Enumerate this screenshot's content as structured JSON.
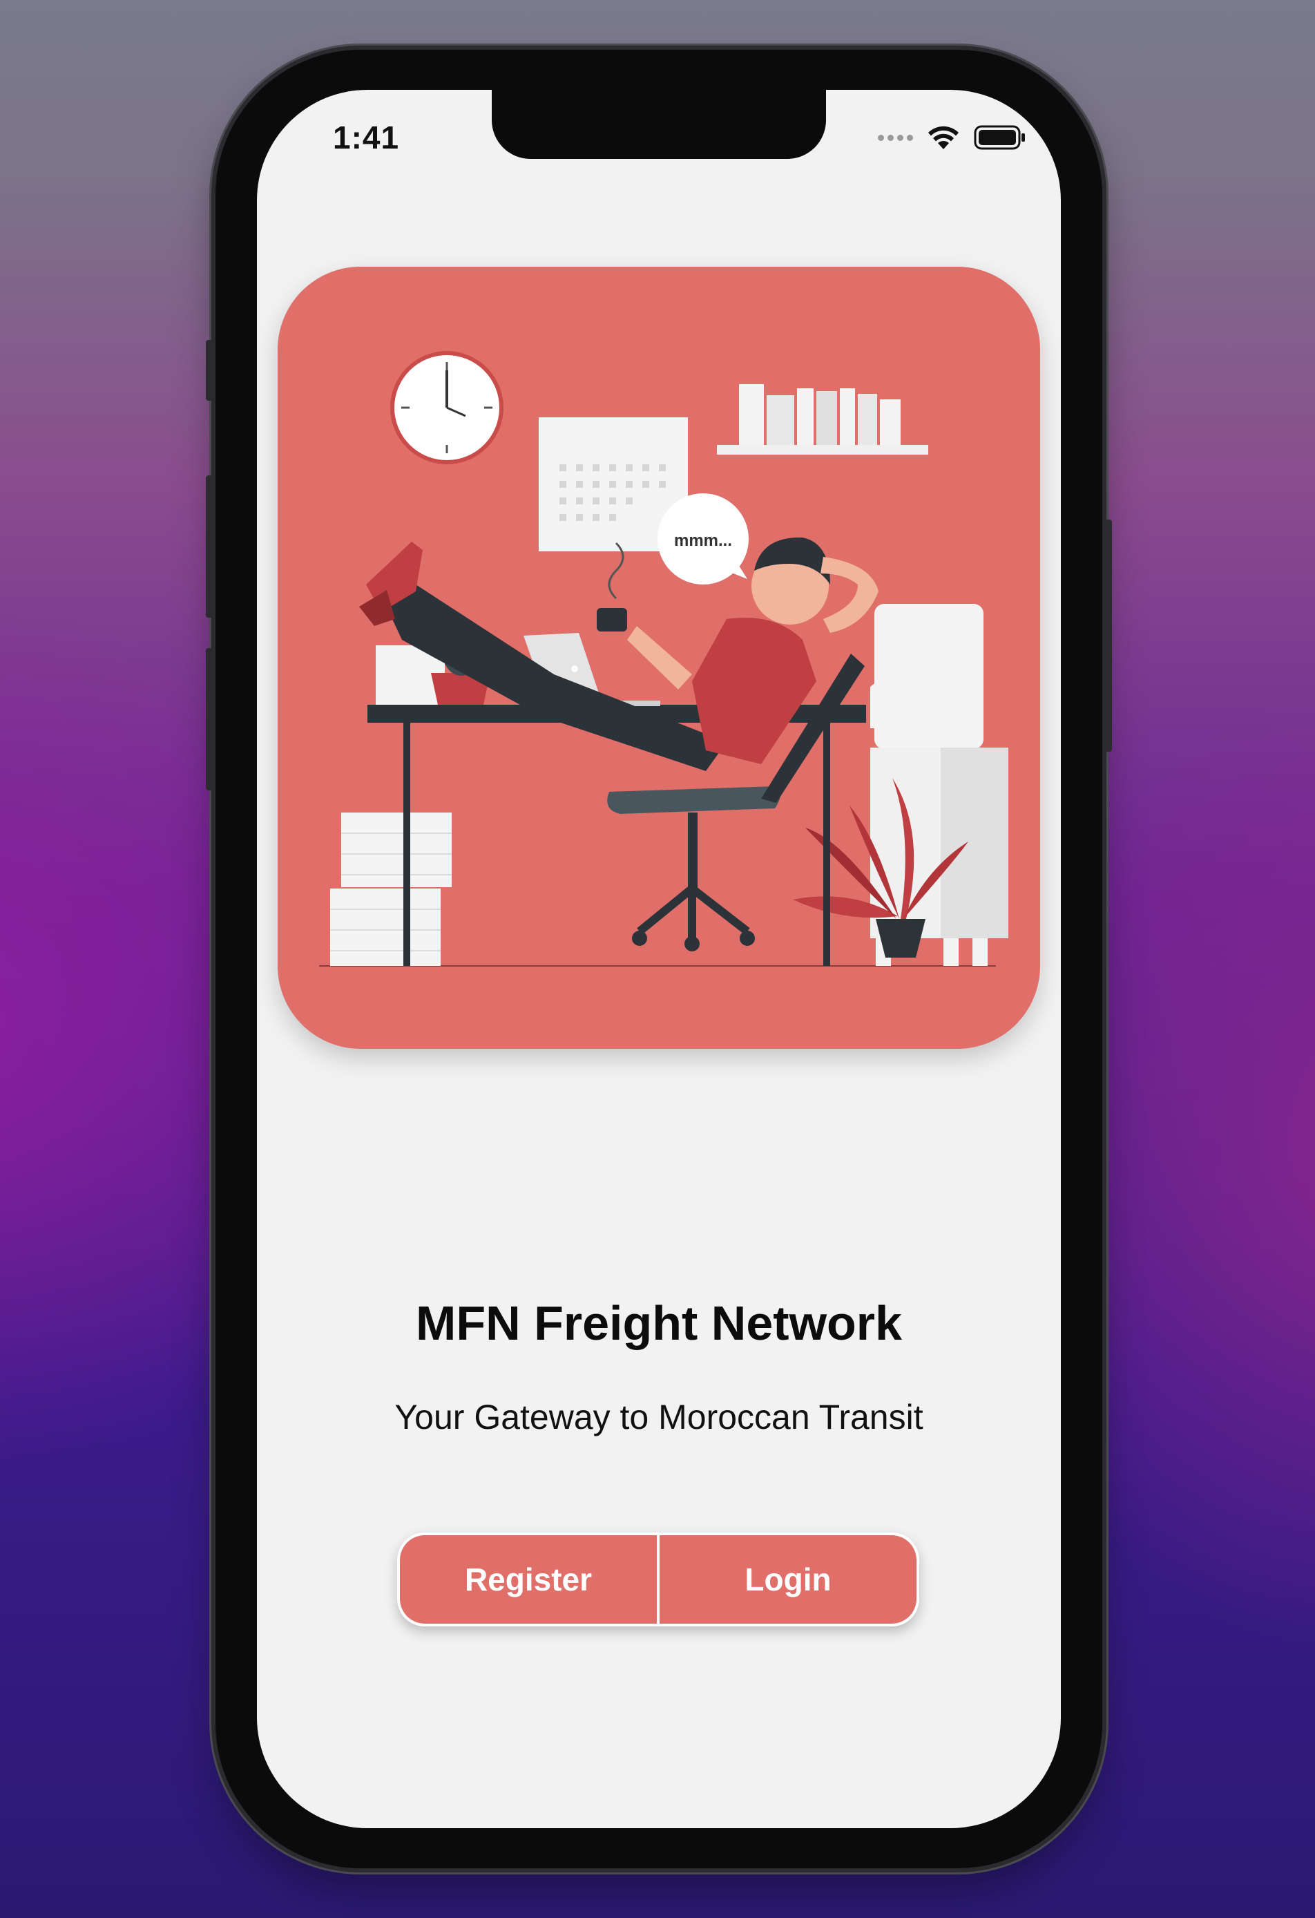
{
  "status_bar": {
    "time": "1:41",
    "icons": [
      "signal-dots-icon",
      "wifi-icon",
      "battery-icon"
    ]
  },
  "hero": {
    "illustration": "relaxing-office-worker-illustration",
    "speech_bubble_text": "mmm...",
    "background_color": "#e06e69"
  },
  "main": {
    "title": "MFN Freight Network",
    "subtitle": "Your Gateway to Moroccan Transit"
  },
  "actions": {
    "register_label": "Register",
    "login_label": "Login",
    "button_color": "#e06e69"
  }
}
